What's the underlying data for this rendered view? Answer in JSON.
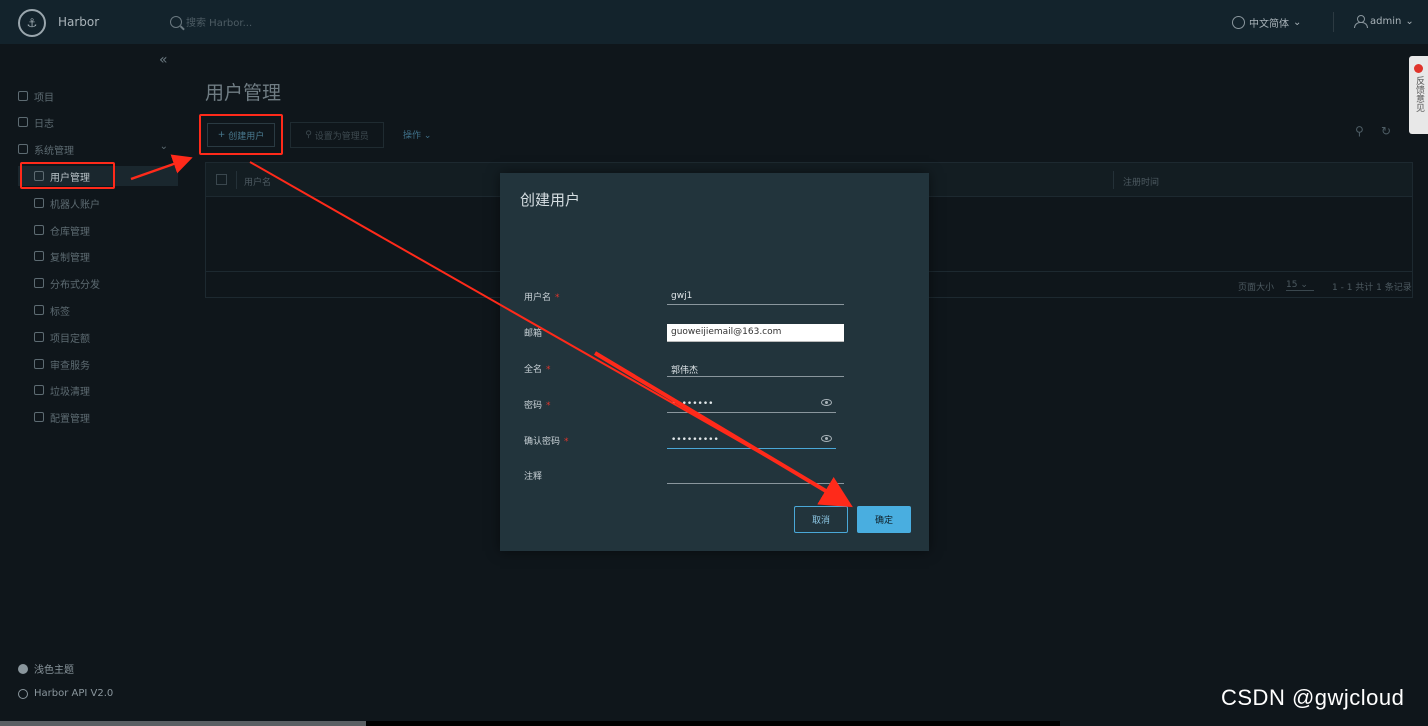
{
  "header": {
    "brand": "Harbor",
    "search_placeholder": "搜索 Harbor...",
    "language": "中文简体",
    "user": "admin"
  },
  "sidebar": {
    "items": [
      {
        "label": "项目",
        "icon": "project-icon"
      },
      {
        "label": "日志",
        "icon": "log-icon"
      },
      {
        "label": "系统管理",
        "icon": "admin-icon"
      }
    ],
    "sub_items": [
      {
        "label": "用户管理",
        "icon": "users-icon"
      },
      {
        "label": "机器人账户",
        "icon": "robot-icon"
      },
      {
        "label": "仓库管理",
        "icon": "registry-icon"
      },
      {
        "label": "复制管理",
        "icon": "replication-icon"
      },
      {
        "label": "分布式分发",
        "icon": "distribution-icon"
      },
      {
        "label": "标签",
        "icon": "tag-icon"
      },
      {
        "label": "项目定额",
        "icon": "quota-icon"
      },
      {
        "label": "审查服务",
        "icon": "shield-icon"
      },
      {
        "label": "垃圾清理",
        "icon": "trash-icon"
      },
      {
        "label": "配置管理",
        "icon": "gear-icon"
      }
    ],
    "theme_toggle": "浅色主题",
    "api_link": "Harbor API V2.0"
  },
  "main": {
    "title": "用户管理",
    "create_button": "创建用户",
    "set_admin_button": "设置为管理员",
    "actions_menu": "操作",
    "columns": [
      "用户名",
      "注册时间"
    ],
    "page_size_label": "页面大小",
    "page_size_value": "15",
    "pagination_text": "1 - 1 共计 1 条记录"
  },
  "modal": {
    "title": "创建用户",
    "fields": [
      {
        "label": "用户名",
        "required": "*",
        "value": "gwj1"
      },
      {
        "label": "邮箱",
        "required": "",
        "value": "guoweijiemail@163.com"
      },
      {
        "label": "全名",
        "required": "*",
        "value": "郭伟杰"
      },
      {
        "label": "密码",
        "required": "*",
        "value": "••••••••"
      },
      {
        "label": "确认密码",
        "required": "*",
        "value": "•••••••••"
      },
      {
        "label": "注释",
        "required": "",
        "value": ""
      }
    ],
    "cancel_label": "取消",
    "ok_label": "确定"
  },
  "feedback_tab": "反馈意见",
  "watermark": "CSDN @gwjcloud",
  "colors": {
    "accent": "#49aee0",
    "annotation_red": "#ff2a1a",
    "header_bg": "#13232c",
    "modal_bg": "#22343c"
  }
}
